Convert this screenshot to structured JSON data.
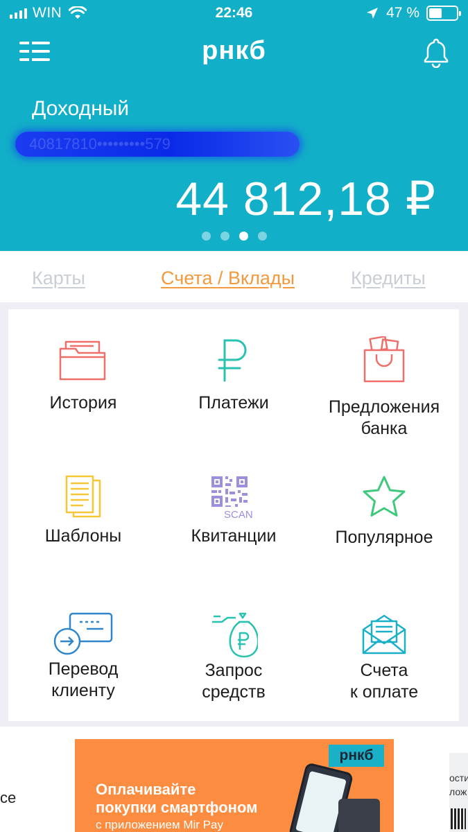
{
  "status_bar": {
    "carrier": "WIN",
    "time": "22:46",
    "battery_percent": "47 %",
    "battery_level": 0.47
  },
  "header": {
    "logo": "рнкб",
    "account_name": "Доходный",
    "account_number_masked": "40817810•••••••••579",
    "balance": "44 812,18 ₽",
    "page_dots": 4,
    "active_dot": 2
  },
  "tabs": [
    {
      "label": "Карты",
      "active": false
    },
    {
      "label": "Счета / Вклады",
      "active": true
    },
    {
      "label": "Кредиты",
      "active": false
    }
  ],
  "tiles": [
    {
      "label": "История",
      "icon": "folder-icon"
    },
    {
      "label": "Платежи",
      "icon": "ruble-icon"
    },
    {
      "label": "Предложения\nбанка",
      "icon": "gift-bag-icon"
    },
    {
      "label": "Шаблоны",
      "icon": "document-icon"
    },
    {
      "label": "Квитанции",
      "icon": "qr-scan-icon",
      "scan_text": "SCAN"
    },
    {
      "label": "Популярное",
      "icon": "star-icon"
    },
    {
      "label": "Перевод\nклиенту",
      "icon": "card-transfer-icon"
    },
    {
      "label": "Запрос\nсредств",
      "icon": "money-bag-icon"
    },
    {
      "label": "Счета\nк оплате",
      "icon": "envelope-icon"
    }
  ],
  "banner": {
    "logo": "рнкб",
    "title": "Оплачивайте\nпокупки смартфоном",
    "subtitle": "с приложением Mir Pay"
  },
  "side_left_text": "се",
  "side_right_text": "ости\nлож",
  "colors": {
    "header": "#12afc8",
    "accent_orange": "#f49a3d",
    "tab_inactive": "#c8ced3",
    "icon_red": "#ee6f6a",
    "icon_teal": "#27c2b0",
    "icon_yellow": "#f7c634",
    "icon_purple": "#9b8fe0",
    "icon_green": "#3ec97c",
    "icon_blue": "#2f86c9",
    "banner": "#fb8c40"
  }
}
